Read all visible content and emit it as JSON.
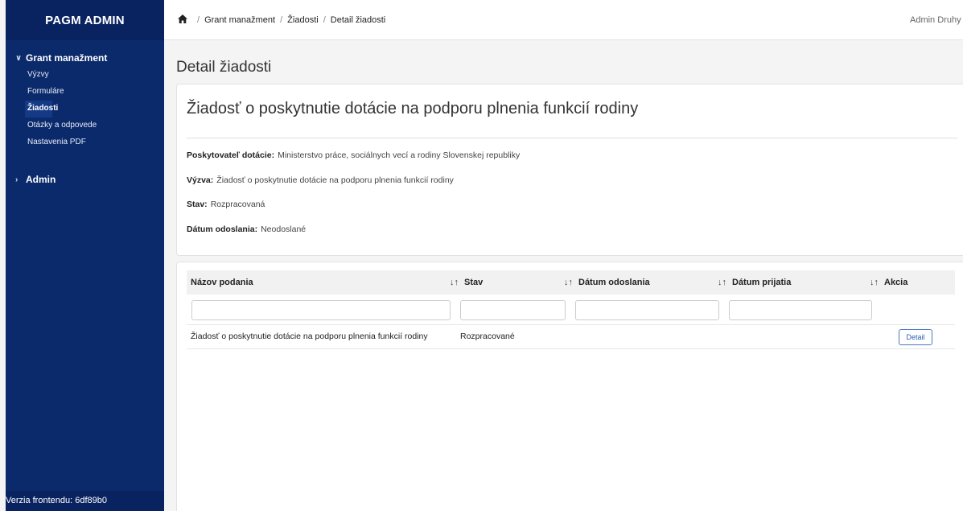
{
  "sidebar": {
    "brand": "PAGM ADMIN",
    "groups": [
      {
        "title": "Grant manažment",
        "chevron": "chevron-down-icon",
        "expanded": true,
        "items": [
          {
            "label": "Výzvy",
            "active": false
          },
          {
            "label": "Formuláre",
            "active": false
          },
          {
            "label": "Žiadosti",
            "active": true
          },
          {
            "label": "Otázky a odpovede",
            "active": false
          },
          {
            "label": "Nastavenia PDF",
            "active": false
          }
        ]
      },
      {
        "title": "Admin",
        "chevron": "chevron-right-icon",
        "expanded": false
      }
    ],
    "footer": "Verzia frontendu: 6df89b0"
  },
  "topbar": {
    "home_icon": "home-icon",
    "breadcrumb": [
      "Grant manažment",
      "Žiadosti",
      "Detail žiadosti"
    ],
    "user": "Admin Druhy"
  },
  "page": {
    "title": "Detail žiadosti"
  },
  "detail": {
    "heading": "Žiadosť o poskytnutie dotácie na podporu plnenia funkcií rodiny",
    "fields": [
      {
        "label": "Poskytovateľ dotácie:",
        "value": "Ministerstvo práce, sociálnych vecí a rodiny Slovenskej republiky"
      },
      {
        "label": "Výzva:",
        "value": "Žiadosť o poskytnutie dotácie na podporu plnenia funkcií rodiny"
      },
      {
        "label": "Stav:",
        "value": "Rozpracovaná"
      },
      {
        "label": "Dátum odoslania:",
        "value": "Neodoslané"
      }
    ]
  },
  "table": {
    "columns": [
      "Názov podania",
      "Stav",
      "Dátum odoslania",
      "Dátum prijatia",
      "Akcia"
    ],
    "sort_icon": "↓↑",
    "rows": [
      {
        "name": "Žiadosť o poskytnutie dotácie na podporu plnenia funkcií rodiny",
        "status": "Rozpracované",
        "sent": "",
        "received": "",
        "action": "Detail"
      }
    ]
  },
  "colors": {
    "sidebar": "#0b2a6b",
    "sidebar_header": "#092360",
    "accent": "#2a5db0"
  }
}
